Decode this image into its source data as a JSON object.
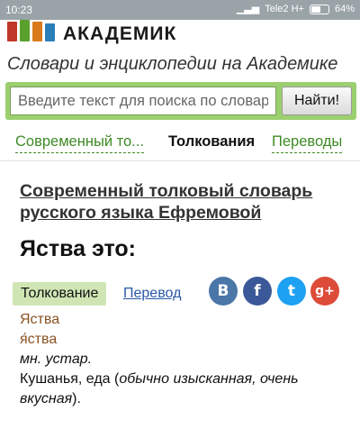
{
  "status_bar": {
    "time": "10:23",
    "carrier": "Tele2 H+",
    "battery": "64%",
    "battery_level": 0.64
  },
  "header": {
    "logo_text": "АКАДЕМИК",
    "tagline": "Словари и энциклопедии на Академике"
  },
  "search": {
    "placeholder": "Введите текст для поиска по словарям",
    "button_label": "Найти!"
  },
  "tabs": [
    {
      "label": "Современный то...",
      "active": false
    },
    {
      "label": "Толкования",
      "active": true
    },
    {
      "label": "Переводы",
      "active": false
    }
  ],
  "dictionary_title": "Современный толковый словарь русского языка Ефремовой",
  "word_heading": "Яства это:",
  "subtabs": {
    "active": "Толкование",
    "link": "Перевод"
  },
  "share": [
    {
      "name": "vk",
      "glyph": "B",
      "color": "#4a76a8"
    },
    {
      "name": "facebook",
      "glyph": "f",
      "color": "#3b5998"
    },
    {
      "name": "twitter",
      "glyph": "t",
      "color": "#1da1f2"
    },
    {
      "name": "google-plus",
      "glyph": "g+",
      "color": "#dd4b39"
    }
  ],
  "entry": {
    "headword": "Яства",
    "accented": "я́ства",
    "grammar": "мн. устар.",
    "definition_prefix": "Кушанья, еда (",
    "definition_italic": "обычно изысканная, очень вкусная",
    "definition_suffix": ")."
  },
  "colors": {
    "accent_green": "#3e8a26",
    "search_border": "#9ccf6f",
    "link_blue": "#2a58a6",
    "entry_brown": "#8a5222"
  }
}
